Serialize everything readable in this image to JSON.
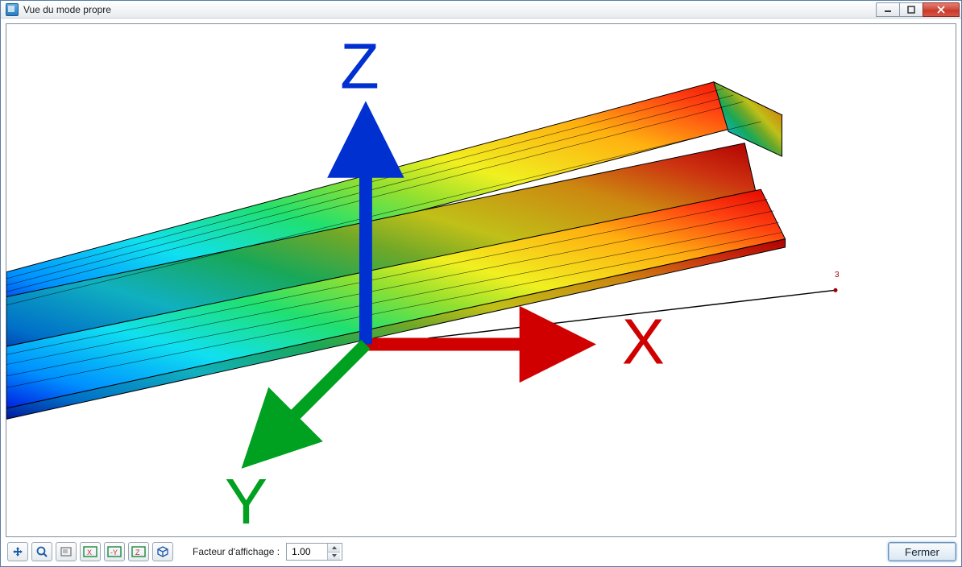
{
  "window": {
    "title": "Vue du mode propre"
  },
  "viewport": {
    "node_label": "3",
    "axes": {
      "x": "X",
      "y": "Y",
      "z": "Z"
    }
  },
  "toolbar": {
    "factor_label": "Facteur d'affichage :",
    "factor_value": "1.00",
    "close_label": "Fermer"
  }
}
